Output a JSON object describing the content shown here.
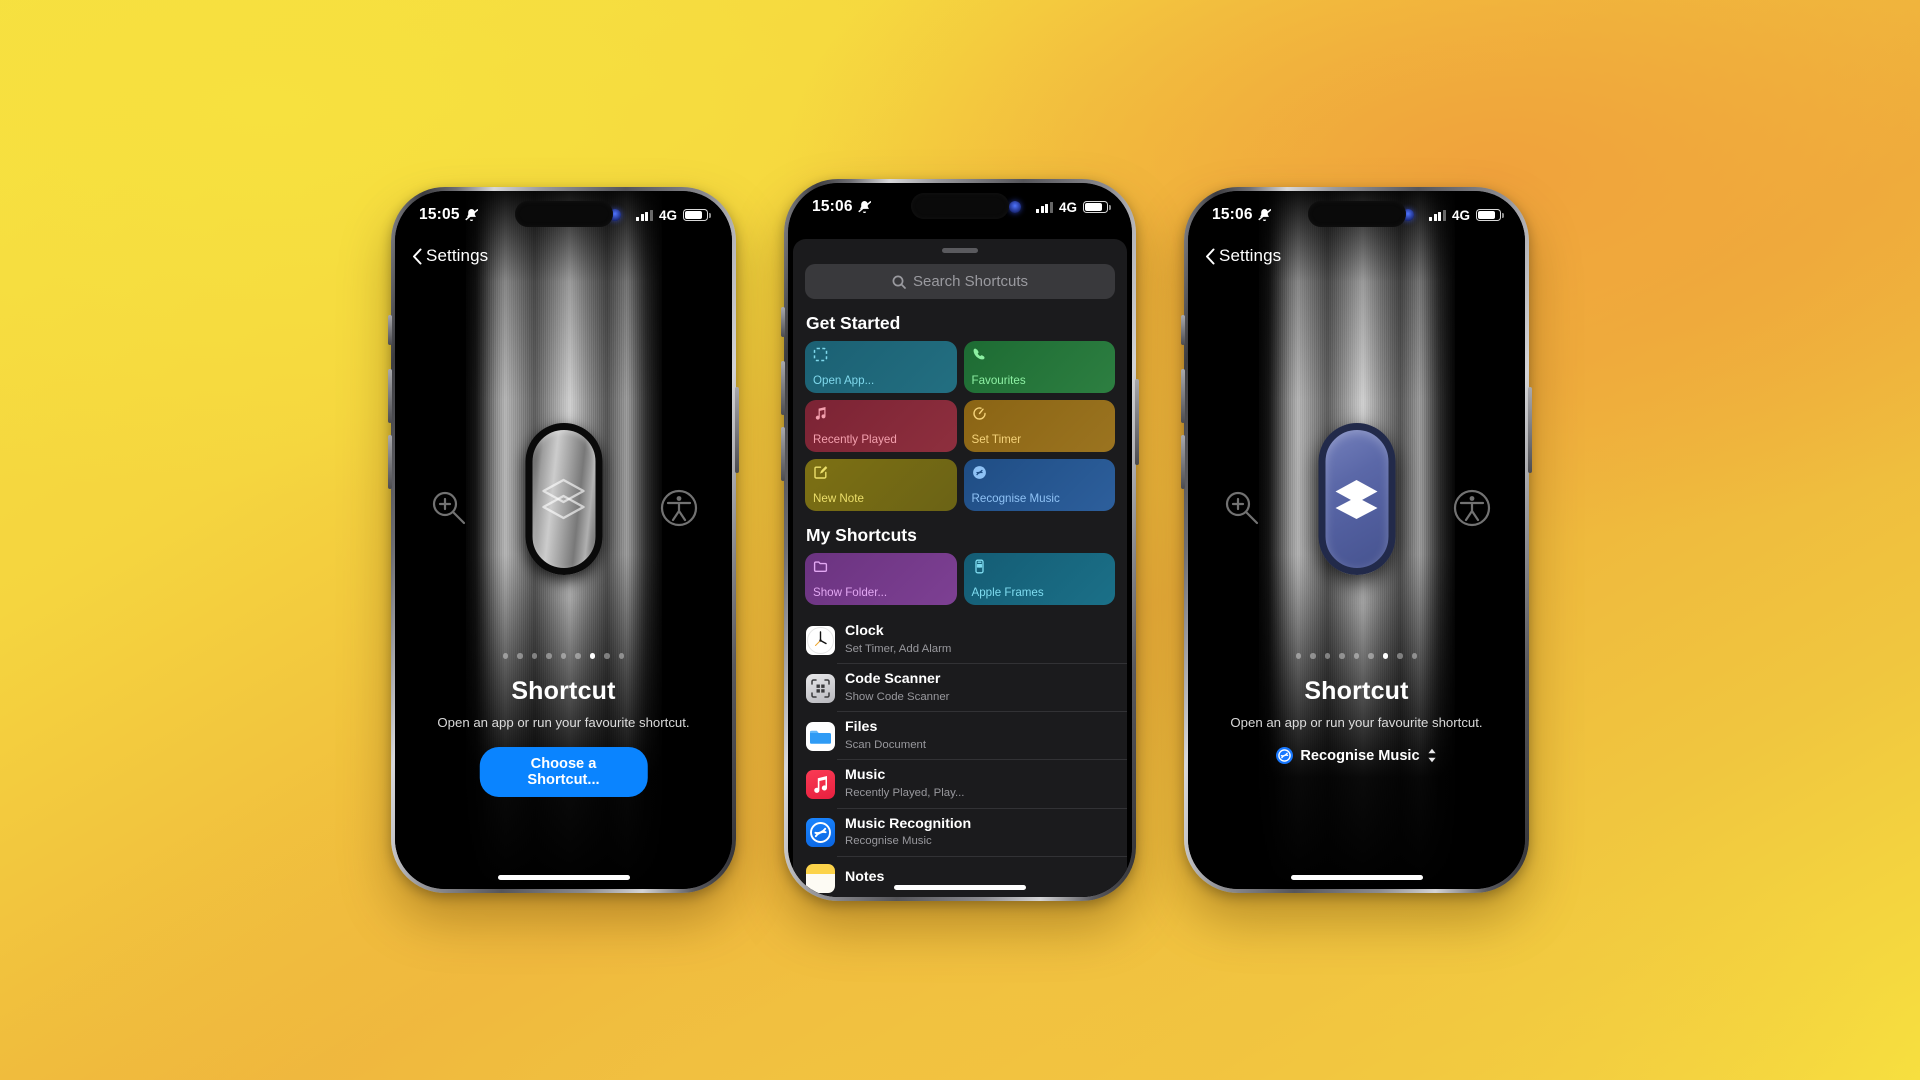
{
  "background": {
    "colors": [
      "#f6e040",
      "#eeb23c",
      "#f0a23c"
    ]
  },
  "accent": {
    "blue": "#0a84ff",
    "shazam_blue": "#1878ff"
  },
  "phones": [
    {
      "id": "phone-left",
      "statusbar": {
        "time": "15:05",
        "mute_icon": "bell-slash-icon",
        "network": "4G",
        "battery_icon": "battery-icon",
        "focus_icon": "blue-dot-icon"
      },
      "navbar": {
        "back_icon": "chevron-left-icon",
        "title": "Settings"
      },
      "hero": {
        "button_state": "inactive",
        "glyph": "layers-icon",
        "left_glyph": "magnifier-plus-icon",
        "right_glyph": "accessibility-icon",
        "dots_total": 9,
        "dots_active_index": 6,
        "title": "Shortcut",
        "subtitle": "Open an app or run your favourite shortcut.",
        "cta_label": "Choose a Shortcut..."
      }
    },
    {
      "id": "phone-middle",
      "statusbar": {
        "time": "15:06",
        "mute_icon": "bell-slash-icon",
        "network": "4G",
        "battery_icon": "battery-icon",
        "focus_icon": "blue-dot-icon"
      },
      "sheet": {
        "grabber": "sheet-grabber",
        "search": {
          "icon": "search-icon",
          "placeholder": "Search Shortcuts",
          "value": ""
        },
        "sections": [
          {
            "title": "Get Started",
            "tiles": [
              {
                "label": "Open App...",
                "icon": "dashed-square-icon",
                "bg_from": "#1b6073",
                "bg_to": "#206a7c",
                "fg": "#7fd8ec"
              },
              {
                "label": "Favourites",
                "icon": "phone-icon",
                "bg_from": "#1d6b33",
                "bg_to": "#2a7a3d",
                "fg": "#8df0a3"
              },
              {
                "label": "Recently Played",
                "icon": "music-note-icon",
                "bg_from": "#7b2334",
                "bg_to": "#8b2c3b",
                "fg": "#f4a0ae"
              },
              {
                "label": "Set Timer",
                "icon": "timer-icon",
                "bg_from": "#8a6414",
                "bg_to": "#96701c",
                "fg": "#f5d37a"
              },
              {
                "label": "New Note",
                "icon": "compose-icon",
                "bg_from": "#7d7014",
                "bg_to": "#6f6715",
                "fg": "#ecdf6a"
              },
              {
                "label": "Recognise Music",
                "icon": "shazam-icon",
                "bg_from": "#1f4d84",
                "bg_to": "#2a5a96",
                "fg": "#8fc2f5"
              }
            ]
          },
          {
            "title": "My Shortcuts",
            "tiles": [
              {
                "label": "Show Folder...",
                "icon": "folder-icon",
                "bg_from": "#6b3380",
                "bg_to": "#7a3d8f",
                "fg": "#e2a7f2"
              },
              {
                "label": "Apple Frames",
                "icon": "iphone-icon",
                "bg_from": "#145c74",
                "bg_to": "#19697f",
                "fg": "#7fdcf0"
              }
            ]
          }
        ],
        "app_rows": [
          {
            "name": "Clock",
            "detail": "Set Timer, Add Alarm",
            "icon": "clock-app-icon"
          },
          {
            "name": "Code Scanner",
            "detail": "Show Code Scanner",
            "icon": "code-scanner-app-icon"
          },
          {
            "name": "Files",
            "detail": "Scan Document",
            "icon": "files-app-icon"
          },
          {
            "name": "Music",
            "detail": "Recently Played, Play...",
            "icon": "music-app-icon"
          },
          {
            "name": "Music Recognition",
            "detail": "Recognise Music",
            "icon": "shazam-app-icon"
          },
          {
            "name": "Notes",
            "detail": "",
            "icon": "notes-app-icon"
          }
        ]
      }
    },
    {
      "id": "phone-right",
      "statusbar": {
        "time": "15:06",
        "mute_icon": "bell-slash-icon",
        "network": "4G",
        "battery_icon": "battery-icon",
        "focus_icon": "blue-dot-icon"
      },
      "navbar": {
        "back_icon": "chevron-left-icon",
        "title": "Settings"
      },
      "hero": {
        "button_state": "active",
        "glyph": "layers-icon",
        "left_glyph": "magnifier-plus-icon",
        "right_glyph": "accessibility-icon",
        "dots_total": 9,
        "dots_active_index": 6,
        "title": "Shortcut",
        "subtitle": "Open an app or run your favourite shortcut.",
        "selected_shortcut": {
          "label": "Recognise Music",
          "icon": "shazam-icon",
          "picker_icon": "up-down-chevron-icon"
        }
      }
    }
  ]
}
